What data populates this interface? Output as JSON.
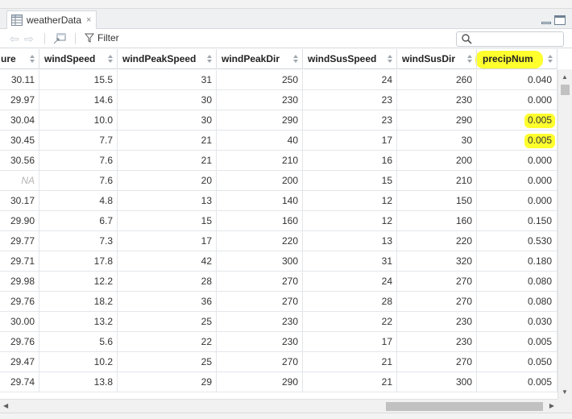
{
  "tab": {
    "label": "weatherData",
    "close_glyph": "×"
  },
  "toolbar": {
    "filter_label": "Filter",
    "search_placeholder": ""
  },
  "columns": [
    "ure",
    "windSpeed",
    "windPeakSpeed",
    "windPeakDir",
    "windSusSpeed",
    "windSusDir",
    "precipNum"
  ],
  "highlighted_column": "precipNum",
  "highlight_color": "#ffff2e",
  "highlighted_cells": [
    2,
    3
  ],
  "rows": [
    [
      "30.11",
      "15.5",
      "31",
      "250",
      "24",
      "260",
      "0.040"
    ],
    [
      "29.97",
      "14.6",
      "30",
      "230",
      "23",
      "230",
      "0.000"
    ],
    [
      "30.04",
      "10.0",
      "30",
      "290",
      "23",
      "290",
      "0.005"
    ],
    [
      "30.45",
      "7.7",
      "21",
      "40",
      "17",
      "30",
      "0.005"
    ],
    [
      "30.56",
      "7.6",
      "21",
      "210",
      "16",
      "200",
      "0.000"
    ],
    [
      "NA",
      "7.6",
      "20",
      "200",
      "15",
      "210",
      "0.000"
    ],
    [
      "30.17",
      "4.8",
      "13",
      "140",
      "12",
      "150",
      "0.000"
    ],
    [
      "29.90",
      "6.7",
      "15",
      "160",
      "12",
      "160",
      "0.150"
    ],
    [
      "29.77",
      "7.3",
      "17",
      "220",
      "13",
      "220",
      "0.530"
    ],
    [
      "29.71",
      "17.8",
      "42",
      "300",
      "31",
      "320",
      "0.180"
    ],
    [
      "29.98",
      "12.2",
      "28",
      "270",
      "24",
      "270",
      "0.080"
    ],
    [
      "29.76",
      "18.2",
      "36",
      "270",
      "28",
      "270",
      "0.080"
    ],
    [
      "30.00",
      "13.2",
      "25",
      "230",
      "22",
      "230",
      "0.030"
    ],
    [
      "29.76",
      "5.6",
      "22",
      "230",
      "17",
      "230",
      "0.005"
    ],
    [
      "29.47",
      "10.2",
      "25",
      "270",
      "21",
      "270",
      "0.050"
    ],
    [
      "29.74",
      "13.8",
      "29",
      "290",
      "21",
      "300",
      "0.005"
    ]
  ],
  "icons": {
    "back": "back-arrow-icon",
    "forward": "forward-arrow-icon",
    "popout": "popout-icon",
    "filter": "filter-icon",
    "search": "search-icon",
    "sort": "sort-icon"
  }
}
